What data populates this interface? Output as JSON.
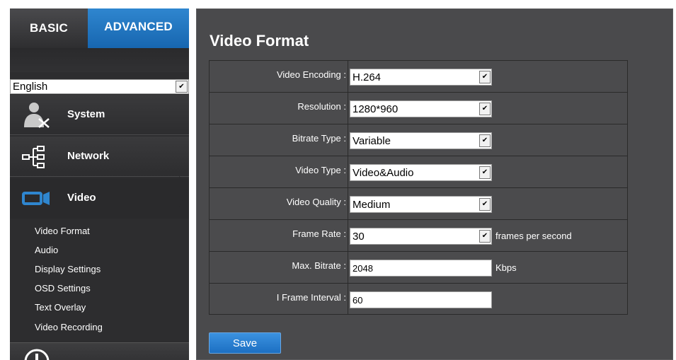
{
  "tabs": {
    "basic": "BASIC",
    "advanced": "ADVANCED"
  },
  "language": {
    "selected": "English"
  },
  "nav": {
    "system": "System",
    "network": "Network",
    "video": "Video"
  },
  "video_subnav": [
    "Video Format",
    "Audio",
    "Display Settings",
    "OSD Settings",
    "Text Overlay",
    "Video Recording"
  ],
  "page": {
    "title": "Video Format"
  },
  "form": {
    "video_encoding": {
      "label": "Video Encoding :",
      "value": "H.264"
    },
    "resolution": {
      "label": "Resolution :",
      "value": "1280*960"
    },
    "bitrate_type": {
      "label": "Bitrate Type :",
      "value": "Variable"
    },
    "video_type": {
      "label": "Video Type :",
      "value": "Video&Audio"
    },
    "video_quality": {
      "label": "Video Quality :",
      "value": "Medium"
    },
    "frame_rate": {
      "label": "Frame Rate :",
      "value": "30",
      "unit": "frames per second"
    },
    "max_bitrate": {
      "label": "Max. Bitrate :",
      "value": "2048",
      "unit": "Kbps"
    },
    "i_frame_interval": {
      "label": "I Frame Interval :",
      "value": "60"
    }
  },
  "buttons": {
    "save": "Save"
  },
  "colors": {
    "accent": "#1c6fc2",
    "panel": "#4a4a4c",
    "sidebar": "#2d2d2f"
  }
}
